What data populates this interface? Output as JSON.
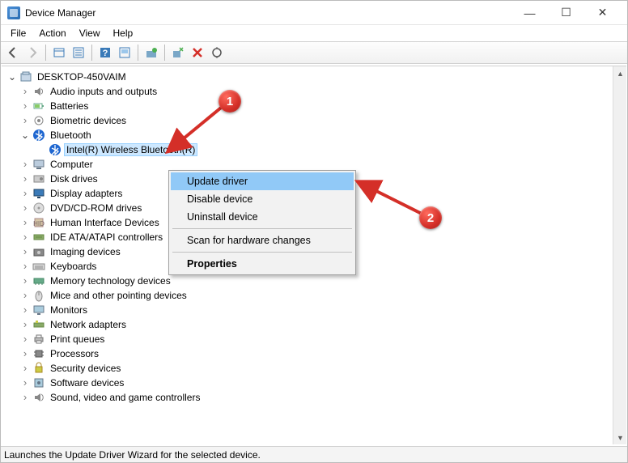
{
  "window": {
    "title": "Device Manager",
    "controls": {
      "minimize": "—",
      "maximize": "☐",
      "close": "✕"
    }
  },
  "menu": {
    "items": [
      "File",
      "Action",
      "View",
      "Help"
    ]
  },
  "toolbar": {
    "buttons": [
      {
        "name": "nav-back-icon"
      },
      {
        "name": "nav-forward-icon"
      },
      {
        "name": "show-hidden-icon"
      },
      {
        "name": "properties-icon"
      },
      {
        "name": "help-icon"
      },
      {
        "name": "device-prop-icon"
      },
      {
        "name": "update-driver-icon"
      },
      {
        "name": "uninstall-icon"
      },
      {
        "name": "remove-icon"
      },
      {
        "name": "scan-hardware-icon"
      }
    ]
  },
  "tree": {
    "root": "DESKTOP-450VAIM",
    "nodes": [
      {
        "label": "Audio inputs and outputs",
        "icon": "audio"
      },
      {
        "label": "Batteries",
        "icon": "battery"
      },
      {
        "label": "Biometric devices",
        "icon": "biometric"
      },
      {
        "label": "Bluetooth",
        "icon": "bluetooth",
        "expanded": true,
        "children": [
          {
            "label": "Intel(R) Wireless Bluetooth(R)",
            "icon": "bluetooth",
            "selected": true
          }
        ]
      },
      {
        "label": "Computer",
        "icon": "computer"
      },
      {
        "label": "Disk drives",
        "icon": "disk"
      },
      {
        "label": "Display adapters",
        "icon": "display"
      },
      {
        "label": "DVD/CD-ROM drives",
        "icon": "dvd"
      },
      {
        "label": "Human Interface Devices",
        "icon": "hid"
      },
      {
        "label": "IDE ATA/ATAPI controllers",
        "icon": "ide"
      },
      {
        "label": "Imaging devices",
        "icon": "imaging"
      },
      {
        "label": "Keyboards",
        "icon": "keyboard"
      },
      {
        "label": "Memory technology devices",
        "icon": "memory"
      },
      {
        "label": "Mice and other pointing devices",
        "icon": "mouse"
      },
      {
        "label": "Monitors",
        "icon": "monitor"
      },
      {
        "label": "Network adapters",
        "icon": "network"
      },
      {
        "label": "Print queues",
        "icon": "printer"
      },
      {
        "label": "Processors",
        "icon": "cpu"
      },
      {
        "label": "Security devices",
        "icon": "security"
      },
      {
        "label": "Software devices",
        "icon": "software"
      },
      {
        "label": "Sound, video and game controllers",
        "icon": "sound"
      }
    ]
  },
  "context_menu": {
    "items": [
      {
        "label": "Update driver",
        "highlight": true
      },
      {
        "label": "Disable device"
      },
      {
        "label": "Uninstall device"
      },
      {
        "sep": true
      },
      {
        "label": "Scan for hardware changes"
      },
      {
        "sep": true
      },
      {
        "label": "Properties",
        "bold": true
      }
    ]
  },
  "statusbar": {
    "text": "Launches the Update Driver Wizard for the selected device."
  },
  "annotations": {
    "badge1": "1",
    "badge2": "2"
  },
  "colors": {
    "selection": "#cde8ff",
    "menu_highlight": "#91c9f7",
    "badge": "#d42f28"
  }
}
